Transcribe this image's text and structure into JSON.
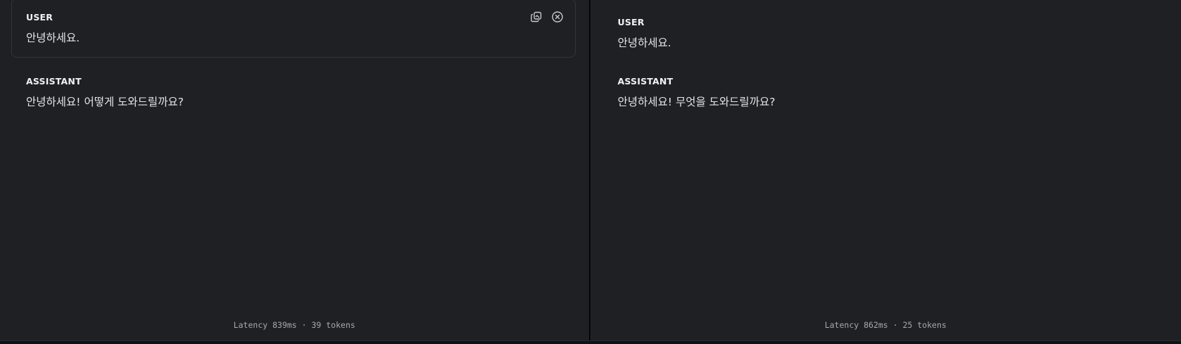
{
  "panes": [
    {
      "user": {
        "role": "USER",
        "text": "안녕하세요."
      },
      "assistant": {
        "role": "ASSISTANT",
        "text": "안녕하세요! 어떻게 도와드릴까요?"
      },
      "footer": {
        "latency": "Latency 839ms · 39 tokens"
      },
      "actions": {
        "icons": [
          "copy-icon",
          "close-circle-icon"
        ]
      }
    },
    {
      "user": {
        "role": "USER",
        "text": "안녕하세요."
      },
      "assistant": {
        "role": "ASSISTANT",
        "text": "안녕하세요! 무엇을 도와드릴까요?"
      },
      "footer": {
        "latency": "Latency 862ms · 25 tokens"
      }
    }
  ],
  "colors": {
    "background": "#1f2023",
    "border": "#34353a",
    "text": "#e4e4e7",
    "muted": "#a8a9ae"
  }
}
